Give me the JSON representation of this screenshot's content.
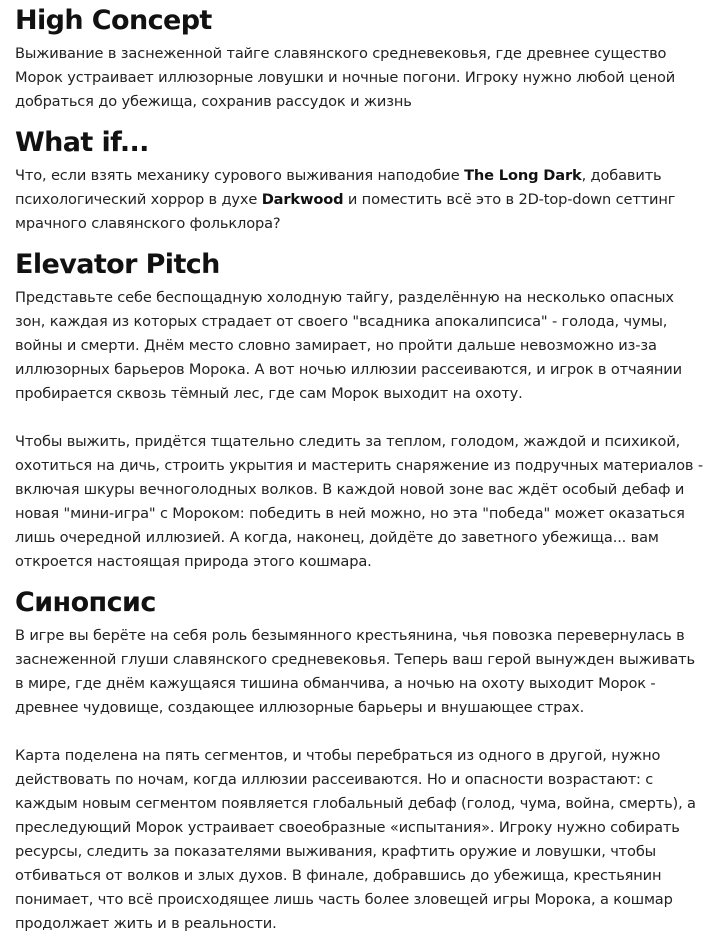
{
  "sections": {
    "high_concept": {
      "heading": "High Concept",
      "paragraphs": [
        "Выживание в заснеженной тайге славянского средневековья, где древнее существо Морок устраивает иллюзорные ловушки и ночные погони. Игроку нужно любой ценой добраться до убежища, сохранив рассудок и жизнь"
      ]
    },
    "what_if": {
      "heading": "What if...",
      "text_1": "Что, если взять механику сурового выживания наподобие ",
      "bold_1": "The Long Dark",
      "text_2": ", добавить психологический хоррор в духе ",
      "bold_2": "Darkwood",
      "text_3": " и поместить всё это в 2D-top-down сеттинг мрачного славянского фольклора?"
    },
    "elevator_pitch": {
      "heading": "Elevator Pitch",
      "paragraphs": [
        "Представьте себе беспощадную холодную тайгу, разделённую на несколько опасных зон, каждая из которых страдает от своего \"всадника апокалипсиса\" - голода, чумы, войны и смерти. Днём место словно замирает, но пройти дальше невозможно из-за иллюзорных барьеров Морока. А вот ночью иллюзии рассеиваются, и игрок в отчаянии пробирается сквозь тёмный лес, где сам Морок выходит на охоту.",
        "Чтобы выжить, придётся тщательно следить за теплом, голодом, жаждой и психикой, охотиться на дичь, строить укрытия и мастерить снаряжение из подручных материалов - включая шкуры вечноголодных волков. В каждой новой зоне вас ждёт особый дебаф и новая \"мини-игра\" с Мороком: победить в ней можно, но эта \"победа\" может оказаться лишь очередной иллюзией. А когда, наконец, дойдёте до заветного убежища... вам откроется настоящая природа этого кошмара."
      ]
    },
    "synopsis": {
      "heading": "Синопсис",
      "paragraphs": [
        "В игре вы берёте на себя роль безымянного крестьянина, чья повозка перевернулась в заснеженной глуши славянского средневековья. Теперь ваш герой вынужден выживать в мире, где днём кажущаяся тишина обманчива, а ночью на охоту выходит Морок - древнее чудовище, создающее иллюзорные барьеры и внушающее страх.",
        "Карта поделена на пять сегментов, и чтобы перебраться из одного в другой, нужно действовать по ночам, когда иллюзии рассеиваются. Но и опасности возрастают: с каждым новым сегментом появляется глобальный дебаф (голод, чума, война, смерть), а преследующий Морок устраивает своеобразные «испытания». Игроку нужно собирать ресурсы, следить за показателями выживания, крафтить оружие и ловушки, чтобы отбиваться от волков и злых духов. В финале, добравшись до убежища, крестьянин понимает, что всё происходящее лишь часть более зловещей игры Морока, а кошмар продолжает жить и в реальности."
      ]
    }
  }
}
